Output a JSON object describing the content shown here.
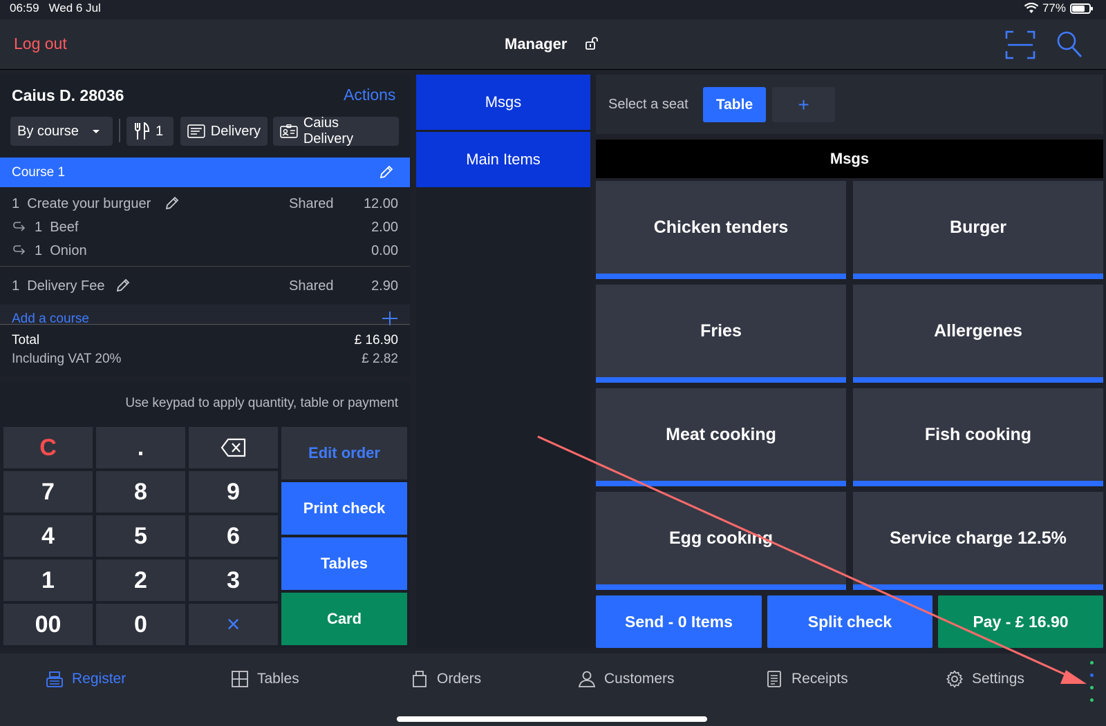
{
  "status_bar": {
    "time": "06:59",
    "date": "Wed 6 Jul",
    "battery": "77%",
    "battery_level": 0.77
  },
  "header": {
    "logout": "Log out",
    "title": "Manager"
  },
  "order": {
    "customer": "Caius D. 28036",
    "actions": "Actions",
    "mode": "By course",
    "covers": "1",
    "delivery": "Delivery",
    "delivery_name": "Caius Delivery",
    "course_label": "Course 1",
    "items": [
      {
        "qty": "1",
        "name": "Create your burguer",
        "share": "Shared",
        "price": "12.00"
      },
      {
        "qty": "1",
        "name": "Beef",
        "price": "2.00"
      },
      {
        "qty": "1",
        "name": "Onion",
        "price": "0.00"
      },
      {
        "qty": "1",
        "name": "Delivery Fee",
        "share": "Shared",
        "price": "2.90"
      }
    ],
    "add_course": "Add a course",
    "total_label": "Total",
    "total_value": "£ 16.90",
    "vat_label": "Including VAT 20%",
    "vat_value": "£ 2.82"
  },
  "keypad": {
    "hint": "Use keypad to apply quantity, table or payment",
    "clear": "C",
    "dot": ".",
    "keys": [
      "7",
      "8",
      "9",
      "4",
      "5",
      "6",
      "1",
      "2",
      "3",
      "00",
      "0"
    ],
    "multiply": "×",
    "edit_order": "Edit order",
    "print_check": "Print check",
    "tables": "Tables",
    "card": "Card"
  },
  "categories": [
    "Msgs",
    "Main Items"
  ],
  "seats": {
    "label": "Select a seat",
    "table": "Table",
    "plus": "+"
  },
  "menu": {
    "header": "Msgs",
    "tiles": [
      "Chicken tenders",
      "Burger",
      "Fries",
      "Allergenes",
      "Meat cooking",
      "Fish cooking",
      "Egg cooking",
      "Service charge 12.5%"
    ]
  },
  "bottom_actions": {
    "send": "Send - 0 Items",
    "split": "Split check",
    "pay": "Pay - £ 16.90"
  },
  "nav": [
    "Register",
    "Tables",
    "Orders",
    "Customers",
    "Receipts",
    "Settings"
  ],
  "colors": {
    "accent": "#2a6cff",
    "green": "#078a5e",
    "danger": "#ff5a5f",
    "annotation": "#ff6b6b"
  }
}
